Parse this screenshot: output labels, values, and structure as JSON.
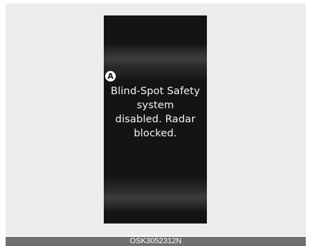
{
  "display": {
    "callout_label": "A",
    "message_lines": [
      "Blind-Spot Safety",
      "system",
      "disabled. Radar",
      "blocked."
    ]
  },
  "figure_code": "OSK3052312N"
}
